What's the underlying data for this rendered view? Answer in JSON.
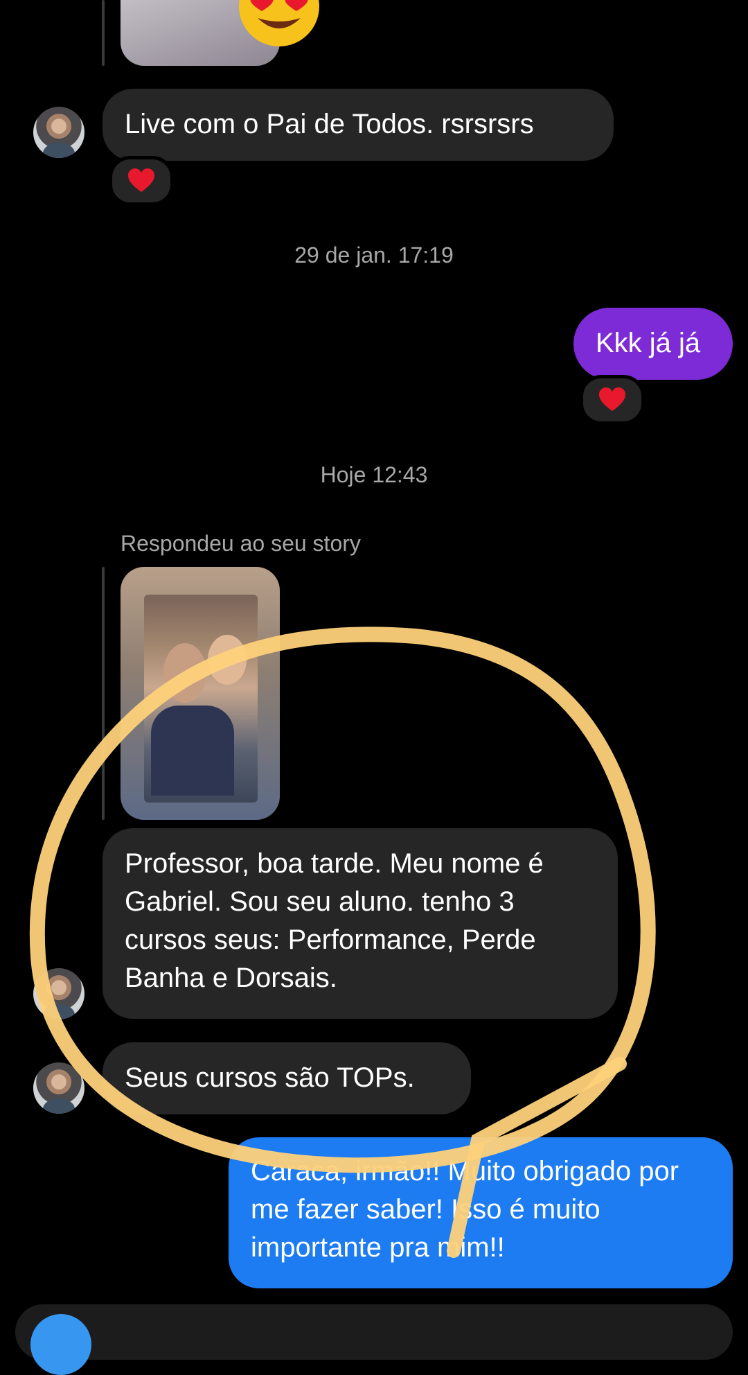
{
  "messages": {
    "live": "Live com o Pai de Todos. rsrsrsrs",
    "kkk": "Kkk já já",
    "professor": "Professor, boa tarde. Meu nome é Gabriel. Sou seu aluno. tenho 3 cursos seus: Performance, Perde Banha e Dorsais.",
    "tops": "Seus cursos são TOPs.",
    "reply": "Caraca, irmão!! Muito obrigado por me fazer saber! Isso é muito importante pra mim!!"
  },
  "timestamps": {
    "t1": "29 de jan. 17:19",
    "t2": "Hoje 12:43"
  },
  "story_reply_label": "Respondeu ao seu story",
  "icons": {
    "heart": "heart-icon",
    "heart_eyes": "heart-eyes-emoji",
    "camera": "camera-icon"
  },
  "colors": {
    "incoming_bubble": "#262626",
    "outgoing_purple": "#7d2bd6",
    "outgoing_blue": "#1d7cf2",
    "annotation_yellow": "#fdd17a",
    "heart_red": "#e8192c"
  }
}
